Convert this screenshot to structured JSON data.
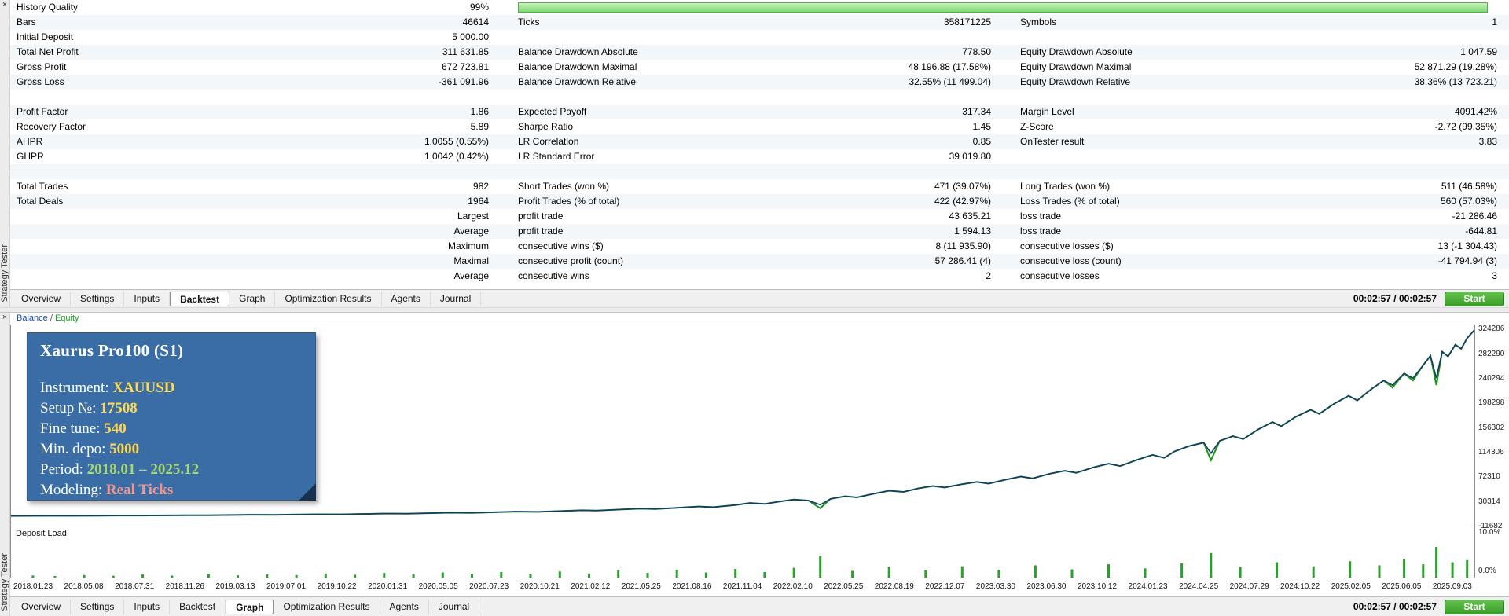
{
  "colors": {
    "balance_line": "#16386b",
    "equity_line": "#169616",
    "deposit_bar": "#2aa12a",
    "quality_bar": "#7fd876",
    "start_green": "#3b9c2a",
    "overlay_bg": "#3a6da6"
  },
  "tabs": [
    "Overview",
    "Settings",
    "Inputs",
    "Backtest",
    "Graph",
    "Optimization Results",
    "Agents",
    "Journal"
  ],
  "top_panel": {
    "side_label": "Strategy Tester",
    "close_label": "×",
    "active_tab": "Backtest",
    "time": "00:02:57 / 00:02:57",
    "start_label": "Start",
    "table": {
      "rows": [
        {
          "c1l": "History Quality",
          "c1v": "99%",
          "bar": true,
          "bar_pct": 99
        },
        {
          "c1l": "Bars",
          "c1v": "46614",
          "c2l": "Ticks",
          "c2v": "358171225",
          "c3l": "Symbols",
          "c3v": "1"
        },
        {
          "c1l": "Initial Deposit",
          "c1v": "5 000.00"
        },
        {
          "c1l": "Total Net Profit",
          "c1v": "311 631.85",
          "c2l": "Balance Drawdown Absolute",
          "c2v": "778.50",
          "c3l": "Equity Drawdown Absolute",
          "c3v": "1 047.59"
        },
        {
          "c1l": "Gross Profit",
          "c1v": "672 723.81",
          "c2l": "Balance Drawdown Maximal",
          "c2v": "48 196.88 (17.58%)",
          "c3l": "Equity Drawdown Maximal",
          "c3v": "52 871.29 (19.28%)"
        },
        {
          "c1l": "Gross Loss",
          "c1v": "-361 091.96",
          "c2l": "Balance Drawdown Relative",
          "c2v": "32.55% (11 499.04)",
          "c3l": "Equity Drawdown Relative",
          "c3v": "38.36% (13 723.21)"
        },
        {},
        {
          "c1l": "Profit Factor",
          "c1v": "1.86",
          "c2l": "Expected Payoff",
          "c2v": "317.34",
          "c3l": "Margin Level",
          "c3v": "4091.42%"
        },
        {
          "c1l": "Recovery Factor",
          "c1v": "5.89",
          "c2l": "Sharpe Ratio",
          "c2v": "1.45",
          "c3l": "Z-Score",
          "c3v": "-2.72 (99.35%)"
        },
        {
          "c1l": "AHPR",
          "c1v": "1.0055 (0.55%)",
          "c2l": "LR Correlation",
          "c2v": "0.85",
          "c3l": "OnTester result",
          "c3v": "3.83"
        },
        {
          "c1l": "GHPR",
          "c1v": "1.0042 (0.42%)",
          "c2l": "LR Standard Error",
          "c2v": "39 019.80"
        },
        {},
        {
          "c1l": "Total Trades",
          "c1v": "982",
          "c2l": "Short Trades (won %)",
          "c2v": "471 (39.07%)",
          "c3l": "Long Trades (won %)",
          "c3v": "511 (46.58%)"
        },
        {
          "c1l": "Total Deals",
          "c1v": "1964",
          "c2l": "Profit Trades (% of total)",
          "c2v": "422 (42.97%)",
          "c3l": "Loss Trades (% of total)",
          "c3v": "560 (57.03%)"
        },
        {
          "c1v": "Largest",
          "c2l": "profit trade",
          "c2v": "43 635.21",
          "c3l": "loss trade",
          "c3v": "-21 286.46"
        },
        {
          "c1v": "Average",
          "c2l": "profit trade",
          "c2v": "1 594.13",
          "c3l": "loss trade",
          "c3v": "-644.81"
        },
        {
          "c1v": "Maximum",
          "c2l": "consecutive wins ($)",
          "c2v": "8 (11 935.90)",
          "c3l": "consecutive losses ($)",
          "c3v": "13 (-1 304.43)"
        },
        {
          "c1v": "Maximal",
          "c2l": "consecutive profit (count)",
          "c2v": "57 286.41 (4)",
          "c3l": "consecutive loss (count)",
          "c3v": "-41 794.94 (3)"
        },
        {
          "c1v": "Average",
          "c2l": "consecutive wins",
          "c2v": "2",
          "c3l": "consecutive losses",
          "c3v": "3"
        }
      ]
    }
  },
  "bottom_panel": {
    "side_label": "Strategy Tester",
    "close_label": "×",
    "active_tab": "Graph",
    "time": "00:02:57 / 00:02:57",
    "start_label": "Start",
    "legend": {
      "balance": "Balance",
      "sep": " / ",
      "equity": "Equity"
    },
    "overlay": {
      "title": "Xaurus Pro100 (S1)",
      "lines": [
        {
          "label": "Instrument: ",
          "value": "XAUUSD",
          "color": "yellow"
        },
        {
          "label": "Setup №: ",
          "value": "17508",
          "color": "yellow"
        },
        {
          "label": "Fine tune: ",
          "value": "540",
          "color": "yellow"
        },
        {
          "label": "Min. depo: ",
          "value": "5000",
          "color": "yellow"
        },
        {
          "label": "Period: ",
          "value": "2018.01 – 2025.12",
          "color": "green"
        },
        {
          "label": "Modeling: ",
          "value": "Real Ticks",
          "color": "salmon"
        }
      ]
    },
    "deposit_label": "Deposit Load",
    "deposit_axis_top": "10.0%",
    "deposit_axis_bottom": "0.0%"
  },
  "chart_data": {
    "type": "line",
    "title": "Balance / Equity backtest curve",
    "ylim": [
      -11682,
      330000
    ],
    "y_ticks": [
      324286,
      282290,
      240294,
      198298,
      156302,
      114306,
      72310,
      30314,
      -11682
    ],
    "x_dates": [
      "2018.01.23",
      "2018.05.08",
      "2018.07.31",
      "2018.11.26",
      "2019.03.13",
      "2019.07.01",
      "2019.10.22",
      "2020.01.31",
      "2020.05.05",
      "2020.07.23",
      "2020.10.21",
      "2021.02.12",
      "2021.05.25",
      "2021.08.16",
      "2021.11.04",
      "2022.02.10",
      "2022.05.25",
      "2022.08.19",
      "2022.12.07",
      "2023.03.30",
      "2023.06.30",
      "2023.10.12",
      "2024.01.23",
      "2024.04.25",
      "2024.07.29",
      "2024.10.22",
      "2025.02.05",
      "2025.06.05",
      "2025.09.03"
    ],
    "series": [
      {
        "name": "Balance",
        "points": [
          [
            0,
            5000
          ],
          [
            0.015,
            5080
          ],
          [
            0.03,
            5200
          ],
          [
            0.045,
            5150
          ],
          [
            0.06,
            5400
          ],
          [
            0.075,
            5650
          ],
          [
            0.09,
            5550
          ],
          [
            0.105,
            5900
          ],
          [
            0.12,
            6200
          ],
          [
            0.135,
            6100
          ],
          [
            0.15,
            6500
          ],
          [
            0.165,
            6900
          ],
          [
            0.18,
            6750
          ],
          [
            0.195,
            7300
          ],
          [
            0.21,
            7800
          ],
          [
            0.225,
            7650
          ],
          [
            0.24,
            8300
          ],
          [
            0.255,
            9000
          ],
          [
            0.27,
            8800
          ],
          [
            0.285,
            9600
          ],
          [
            0.3,
            10400
          ],
          [
            0.315,
            10100
          ],
          [
            0.33,
            11200
          ],
          [
            0.345,
            12300
          ],
          [
            0.36,
            11900
          ],
          [
            0.375,
            13300
          ],
          [
            0.39,
            14600
          ],
          [
            0.4,
            14100
          ],
          [
            0.415,
            15800
          ],
          [
            0.43,
            17400
          ],
          [
            0.44,
            16700
          ],
          [
            0.455,
            18800
          ],
          [
            0.47,
            21000
          ],
          [
            0.48,
            20000
          ],
          [
            0.495,
            23500
          ],
          [
            0.505,
            27000
          ],
          [
            0.515,
            25500
          ],
          [
            0.525,
            29500
          ],
          [
            0.535,
            33000
          ],
          [
            0.545,
            31000
          ],
          [
            0.553,
            24000
          ],
          [
            0.56,
            34000
          ],
          [
            0.57,
            38500
          ],
          [
            0.578,
            36500
          ],
          [
            0.59,
            43000
          ],
          [
            0.6,
            48000
          ],
          [
            0.61,
            46000
          ],
          [
            0.62,
            52000
          ],
          [
            0.63,
            56000
          ],
          [
            0.638,
            53500
          ],
          [
            0.65,
            59000
          ],
          [
            0.66,
            63000
          ],
          [
            0.668,
            60000
          ],
          [
            0.68,
            67000
          ],
          [
            0.69,
            72000
          ],
          [
            0.698,
            69000
          ],
          [
            0.71,
            77000
          ],
          [
            0.72,
            82000
          ],
          [
            0.728,
            78500
          ],
          [
            0.74,
            88000
          ],
          [
            0.75,
            94000
          ],
          [
            0.758,
            90000
          ],
          [
            0.77,
            101000
          ],
          [
            0.78,
            109000
          ],
          [
            0.788,
            104000
          ],
          [
            0.795,
            115000
          ],
          [
            0.805,
            124000
          ],
          [
            0.815,
            130000
          ],
          [
            0.82,
            112000
          ],
          [
            0.826,
            133000
          ],
          [
            0.835,
            141000
          ],
          [
            0.842,
            136000
          ],
          [
            0.852,
            152000
          ],
          [
            0.862,
            165000
          ],
          [
            0.868,
            158000
          ],
          [
            0.878,
            174000
          ],
          [
            0.888,
            186000
          ],
          [
            0.894,
            179000
          ],
          [
            0.904,
            196000
          ],
          [
            0.914,
            210000
          ],
          [
            0.92,
            202000
          ],
          [
            0.93,
            222000
          ],
          [
            0.938,
            236000
          ],
          [
            0.944,
            228000
          ],
          [
            0.952,
            248000
          ],
          [
            0.958,
            240000
          ],
          [
            0.965,
            262000
          ],
          [
            0.97,
            278000
          ],
          [
            0.974,
            240000
          ],
          [
            0.978,
            285000
          ],
          [
            0.982,
            277000
          ],
          [
            0.987,
            297000
          ],
          [
            0.991,
            290000
          ],
          [
            0.995,
            308000
          ],
          [
            1,
            322000
          ]
        ]
      },
      {
        "name": "Equity",
        "based_on": "Balance",
        "overrides": [
          [
            0.553,
            18000
          ],
          [
            0.82,
            100000
          ],
          [
            0.944,
            224000
          ],
          [
            0.958,
            236000
          ],
          [
            0.974,
            228000
          ]
        ]
      }
    ],
    "deposit_load": {
      "ylim": [
        0,
        10
      ],
      "bars": [
        [
          0.015,
          0.4
        ],
        [
          0.03,
          0.3
        ],
        [
          0.05,
          0.5
        ],
        [
          0.07,
          0.35
        ],
        [
          0.09,
          0.6
        ],
        [
          0.11,
          0.4
        ],
        [
          0.135,
          0.7
        ],
        [
          0.155,
          0.45
        ],
        [
          0.175,
          0.6
        ],
        [
          0.195,
          0.5
        ],
        [
          0.215,
          0.8
        ],
        [
          0.235,
          0.55
        ],
        [
          0.255,
          0.9
        ],
        [
          0.275,
          0.6
        ],
        [
          0.295,
          1.0
        ],
        [
          0.315,
          0.7
        ],
        [
          0.335,
          1.1
        ],
        [
          0.355,
          0.75
        ],
        [
          0.375,
          1.2
        ],
        [
          0.395,
          0.8
        ],
        [
          0.415,
          1.4
        ],
        [
          0.435,
          0.9
        ],
        [
          0.455,
          1.5
        ],
        [
          0.475,
          1.0
        ],
        [
          0.495,
          1.7
        ],
        [
          0.515,
          1.1
        ],
        [
          0.535,
          1.9
        ],
        [
          0.553,
          4.2
        ],
        [
          0.575,
          1.3
        ],
        [
          0.6,
          2.0
        ],
        [
          0.625,
          1.4
        ],
        [
          0.65,
          2.2
        ],
        [
          0.675,
          1.5
        ],
        [
          0.7,
          2.4
        ],
        [
          0.725,
          1.6
        ],
        [
          0.75,
          2.6
        ],
        [
          0.775,
          1.8
        ],
        [
          0.8,
          2.8
        ],
        [
          0.82,
          4.8
        ],
        [
          0.84,
          2.0
        ],
        [
          0.865,
          3.0
        ],
        [
          0.89,
          2.2
        ],
        [
          0.915,
          3.2
        ],
        [
          0.935,
          2.4
        ],
        [
          0.952,
          3.6
        ],
        [
          0.965,
          2.6
        ],
        [
          0.974,
          6.0
        ],
        [
          0.985,
          3.0
        ],
        [
          0.995,
          3.4
        ]
      ]
    }
  }
}
